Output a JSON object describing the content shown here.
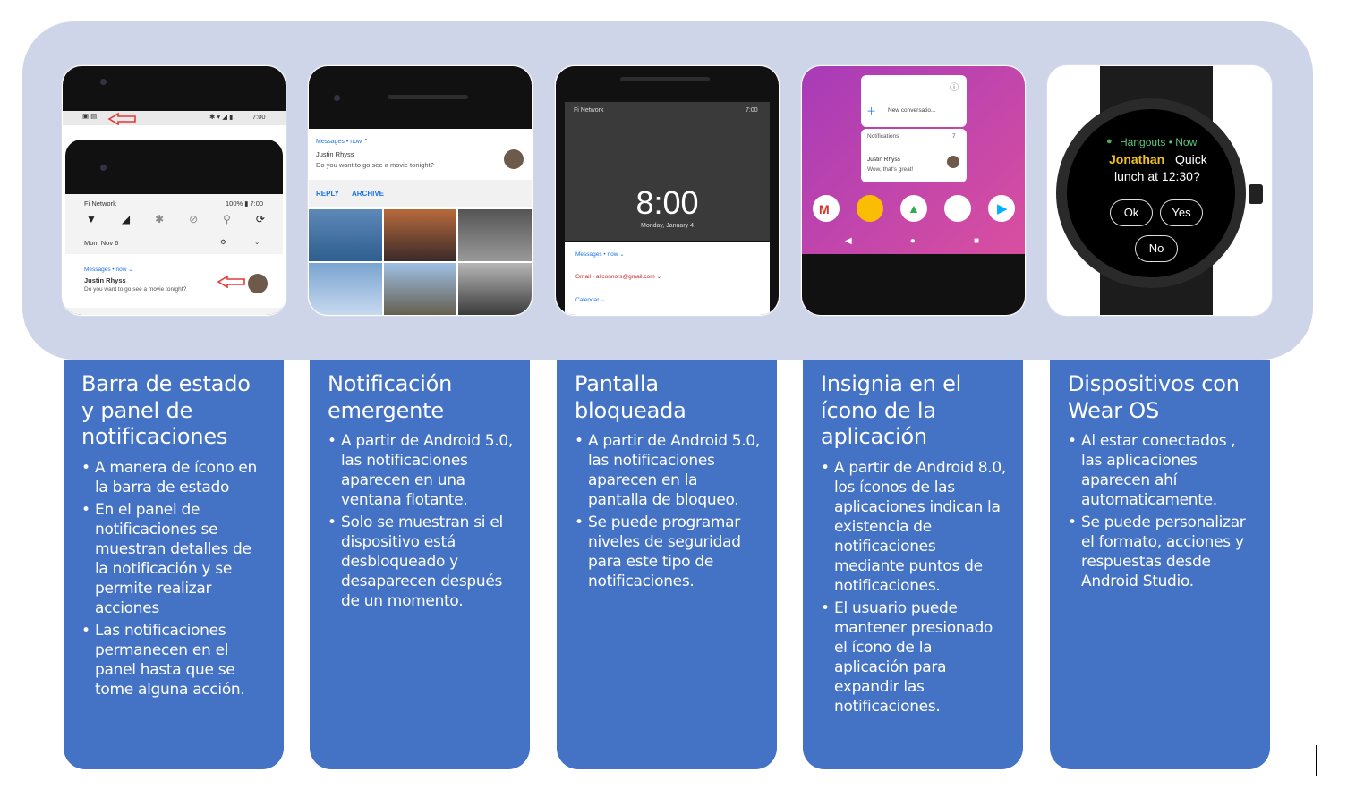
{
  "panel1": {
    "network": "Fi Network",
    "battery": "100% ▮ 7:00",
    "status_time": "7:00",
    "date": "Mon, Nov 6",
    "app": "Messages • now ⌄",
    "sender": "Justin Rhyss",
    "message": "Do you want to go see a movie tonight?"
  },
  "panel2": {
    "app": "Messages • now ⌃",
    "sender": "Justin Rhyss",
    "message": "Do you want to go see a movie tonight?",
    "reply": "REPLY",
    "archive": "ARCHIVE"
  },
  "panel3": {
    "network": "Fi Network",
    "status_time": "7:00",
    "clock": "8:00",
    "date": "Monday, January 4",
    "notif1": "Messages • now ⌄",
    "notif2": "Gmail • aliconnors@gmail.com ⌄",
    "notif3": "Calendar ⌄"
  },
  "panel4": {
    "shortcut": "New conversatio...",
    "notif_header": "Notifications",
    "notif_count": "7",
    "sender": "Justin Rhyss",
    "message": "Wow, that's great!"
  },
  "panel5": {
    "app_line": "Hangouts • Now",
    "sender": "Jonathan",
    "text1": "Quick",
    "text2": "lunch at 12:30?",
    "ok": "Ok",
    "yes": "Yes",
    "no": "No"
  },
  "cards": [
    {
      "title": "Barra de estado y panel de notificaciones",
      "bullets": [
        "A manera de ícono en la barra de estado",
        "En el panel de notificaciones se muestran detalles de la notificación y se permite realizar acciones",
        "Las notificaciones permanecen en el panel hasta que se tome alguna acción."
      ]
    },
    {
      "title": "Notificación emergente",
      "bullets": [
        "A partir de Android 5.0, las notificaciones aparecen en una ventana flotante.",
        "Solo se muestran si el dispositivo está desbloqueado y desaparecen después de un momento."
      ]
    },
    {
      "title": "Pantalla bloqueada",
      "bullets": [
        "A partir de Android 5.0, las notificaciones aparecen en la pantalla de bloqueo.",
        "Se puede programar niveles de seguridad para este tipo de notificaciones."
      ]
    },
    {
      "title": "Insignia en el ícono de la aplicación",
      "bullets": [
        "A partir de Android 8.0, los íconos de las aplicaciones indican la existencia de notificaciones mediante puntos de notificaciones.",
        "El usuario puede mantener presionado el ícono de la aplicación para expandir las notificaciones."
      ]
    },
    {
      "title": "Dispositivos con Wear OS",
      "bullets": [
        "Al estar conectados , las aplicaciones aparecen ahí automaticamente.",
        "Se puede personalizar el formato, acciones y respuestas desde Android Studio."
      ]
    }
  ],
  "colors": {
    "band": "#cfd5e9",
    "card": "#4472c4",
    "arrow": "#e53935",
    "accent_blue": "#1a73e8"
  }
}
